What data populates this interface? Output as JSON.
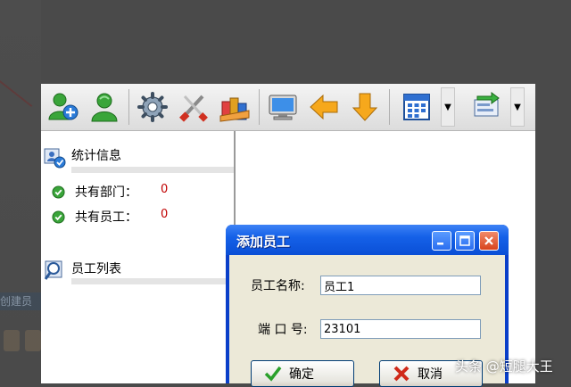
{
  "background": {
    "partial_label": "创建员"
  },
  "app": {
    "toolbar": {
      "buttons": [
        {
          "name": "add-user-button",
          "icon": "user-add-icon"
        },
        {
          "name": "user-button",
          "icon": "user-icon"
        },
        {
          "name": "settings-button",
          "icon": "gear-icon"
        },
        {
          "name": "tools-button",
          "icon": "tools-icon"
        },
        {
          "name": "books-button",
          "icon": "books-icon"
        },
        {
          "name": "monitor-button",
          "icon": "monitor-icon"
        },
        {
          "name": "back-button",
          "icon": "arrow-left-icon"
        },
        {
          "name": "download-button",
          "icon": "arrow-down-icon"
        },
        {
          "name": "calendar-button",
          "icon": "calendar-icon"
        },
        {
          "name": "transfer-button",
          "icon": "transfer-icon"
        }
      ]
    },
    "left_panel": {
      "stats_section": {
        "title": "统计信息",
        "rows": [
          {
            "label": "共有部门：",
            "value": "0"
          },
          {
            "label": "共有员工：",
            "value": "0"
          }
        ]
      },
      "list_section": {
        "title": "员工列表"
      }
    }
  },
  "dialog": {
    "title": "添加员工",
    "name_label": "员工名称:",
    "name_value": "员工1",
    "port_label": "端 口 号:",
    "port_value": "23101",
    "ok_label": "确定",
    "cancel_label": "取消"
  },
  "watermark": "头条 @短腿大王",
  "colors": {
    "dialog_title": "#0a4fd6",
    "stat_value": "#c00000",
    "dialog_body": "#ece9d8"
  }
}
